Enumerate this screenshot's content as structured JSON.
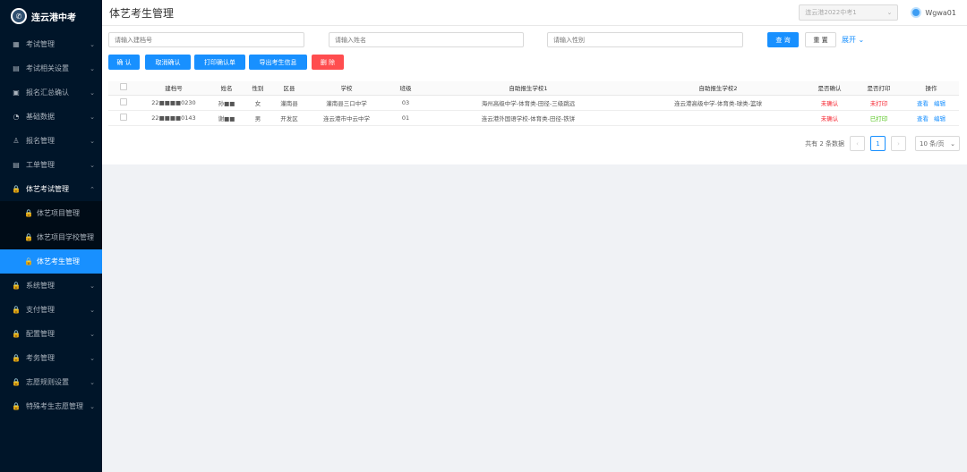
{
  "app": {
    "title": "连云港中考",
    "logo_glyph": "✆"
  },
  "sidebar": {
    "items": [
      {
        "label": "考试管理",
        "icon": "grid-icon",
        "glyph": "▦",
        "chev": "⌄"
      },
      {
        "label": "考试相关设置",
        "icon": "doc-icon",
        "glyph": "▤",
        "chev": "⌄"
      },
      {
        "label": "报名汇总确认",
        "icon": "box-icon",
        "glyph": "▣",
        "chev": "⌄"
      },
      {
        "label": "基础数据",
        "icon": "pie-icon",
        "glyph": "◔",
        "chev": "⌄"
      },
      {
        "label": "报名管理",
        "icon": "user-icon",
        "glyph": "♙",
        "chev": "⌄"
      },
      {
        "label": "工单管理",
        "icon": "doc-icon",
        "glyph": "▤",
        "chev": "⌄"
      }
    ],
    "open_item": {
      "label": "体艺考试管理",
      "icon": "lock-icon",
      "glyph": "🔒",
      "chev": "⌃"
    },
    "sub_items": [
      {
        "label": "体艺项目管理",
        "glyph": "🔒"
      },
      {
        "label": "体艺项目学校管理",
        "glyph": "🔒"
      },
      {
        "label": "体艺考生管理",
        "glyph": "🔒"
      }
    ],
    "items_after": [
      {
        "label": "系统管理",
        "glyph": "🔒",
        "chev": "⌄"
      },
      {
        "label": "支付管理",
        "glyph": "🔒",
        "chev": "⌄"
      },
      {
        "label": "配置管理",
        "glyph": "🔒",
        "chev": "⌄"
      },
      {
        "label": "考务管理",
        "glyph": "🔒",
        "chev": "⌄"
      },
      {
        "label": "志愿规则设置",
        "glyph": "🔒",
        "chev": "⌄"
      },
      {
        "label": "特殊考生志愿管理",
        "glyph": "🔒",
        "chev": "⌄"
      }
    ]
  },
  "header": {
    "title": "体艺考生管理",
    "exam_select": "连云港2022中考1",
    "exam_select_chev": "⌄",
    "user_name": "Wgwa01"
  },
  "search": {
    "placeholder_id": "请输入建档号",
    "placeholder_name": "请输入姓名",
    "placeholder_gender": "请输入性别",
    "query_label": "查 询",
    "reset_label": "重 置",
    "expand_label": "展开 ⌄"
  },
  "actions": {
    "confirm": "确 认",
    "cancel_confirm": "取消确认",
    "print_confirm": "打印确认单",
    "export": "导出考生信息",
    "delete": "删 除"
  },
  "table": {
    "headers": [
      "建档号",
      "姓名",
      "性别",
      "区县",
      "学校",
      "班级",
      "自助报生学校1",
      "自助报生学校2",
      "是否确认",
      "是否打印",
      "操作"
    ],
    "rows": [
      {
        "id": "22■■■■0230",
        "name": "孙■■",
        "gender": "女",
        "district": "灌南县",
        "school": "灌南县三口中学",
        "class": "03",
        "school1": "海州高级中学-体育类-田径-三级跳远",
        "school2": "连云港高级中学-体育类-球类-篮球",
        "confirmed": "未确认",
        "printed": "未打印",
        "view": "查看",
        "edit": "编辑"
      },
      {
        "id": "22■■■■0143",
        "name": "谢■■",
        "gender": "男",
        "district": "开发区",
        "school": "连云港市中云中学",
        "class": "01",
        "school1": "连云港外国语学校-体育类-田径-铁饼",
        "school2": "",
        "confirmed": "未确认",
        "printed": "已打印",
        "view": "查看",
        "edit": "编辑"
      }
    ]
  },
  "pager": {
    "total_text": "共有 2 条数据",
    "prev": "‹",
    "current": "1",
    "next": "›",
    "page_size": "10 条/页",
    "page_size_chev": "⌄"
  },
  "colors": {
    "sidebar_bg": "#001529",
    "accent": "#1890ff",
    "danger": "#ff4d4f",
    "success": "#52c41a"
  }
}
